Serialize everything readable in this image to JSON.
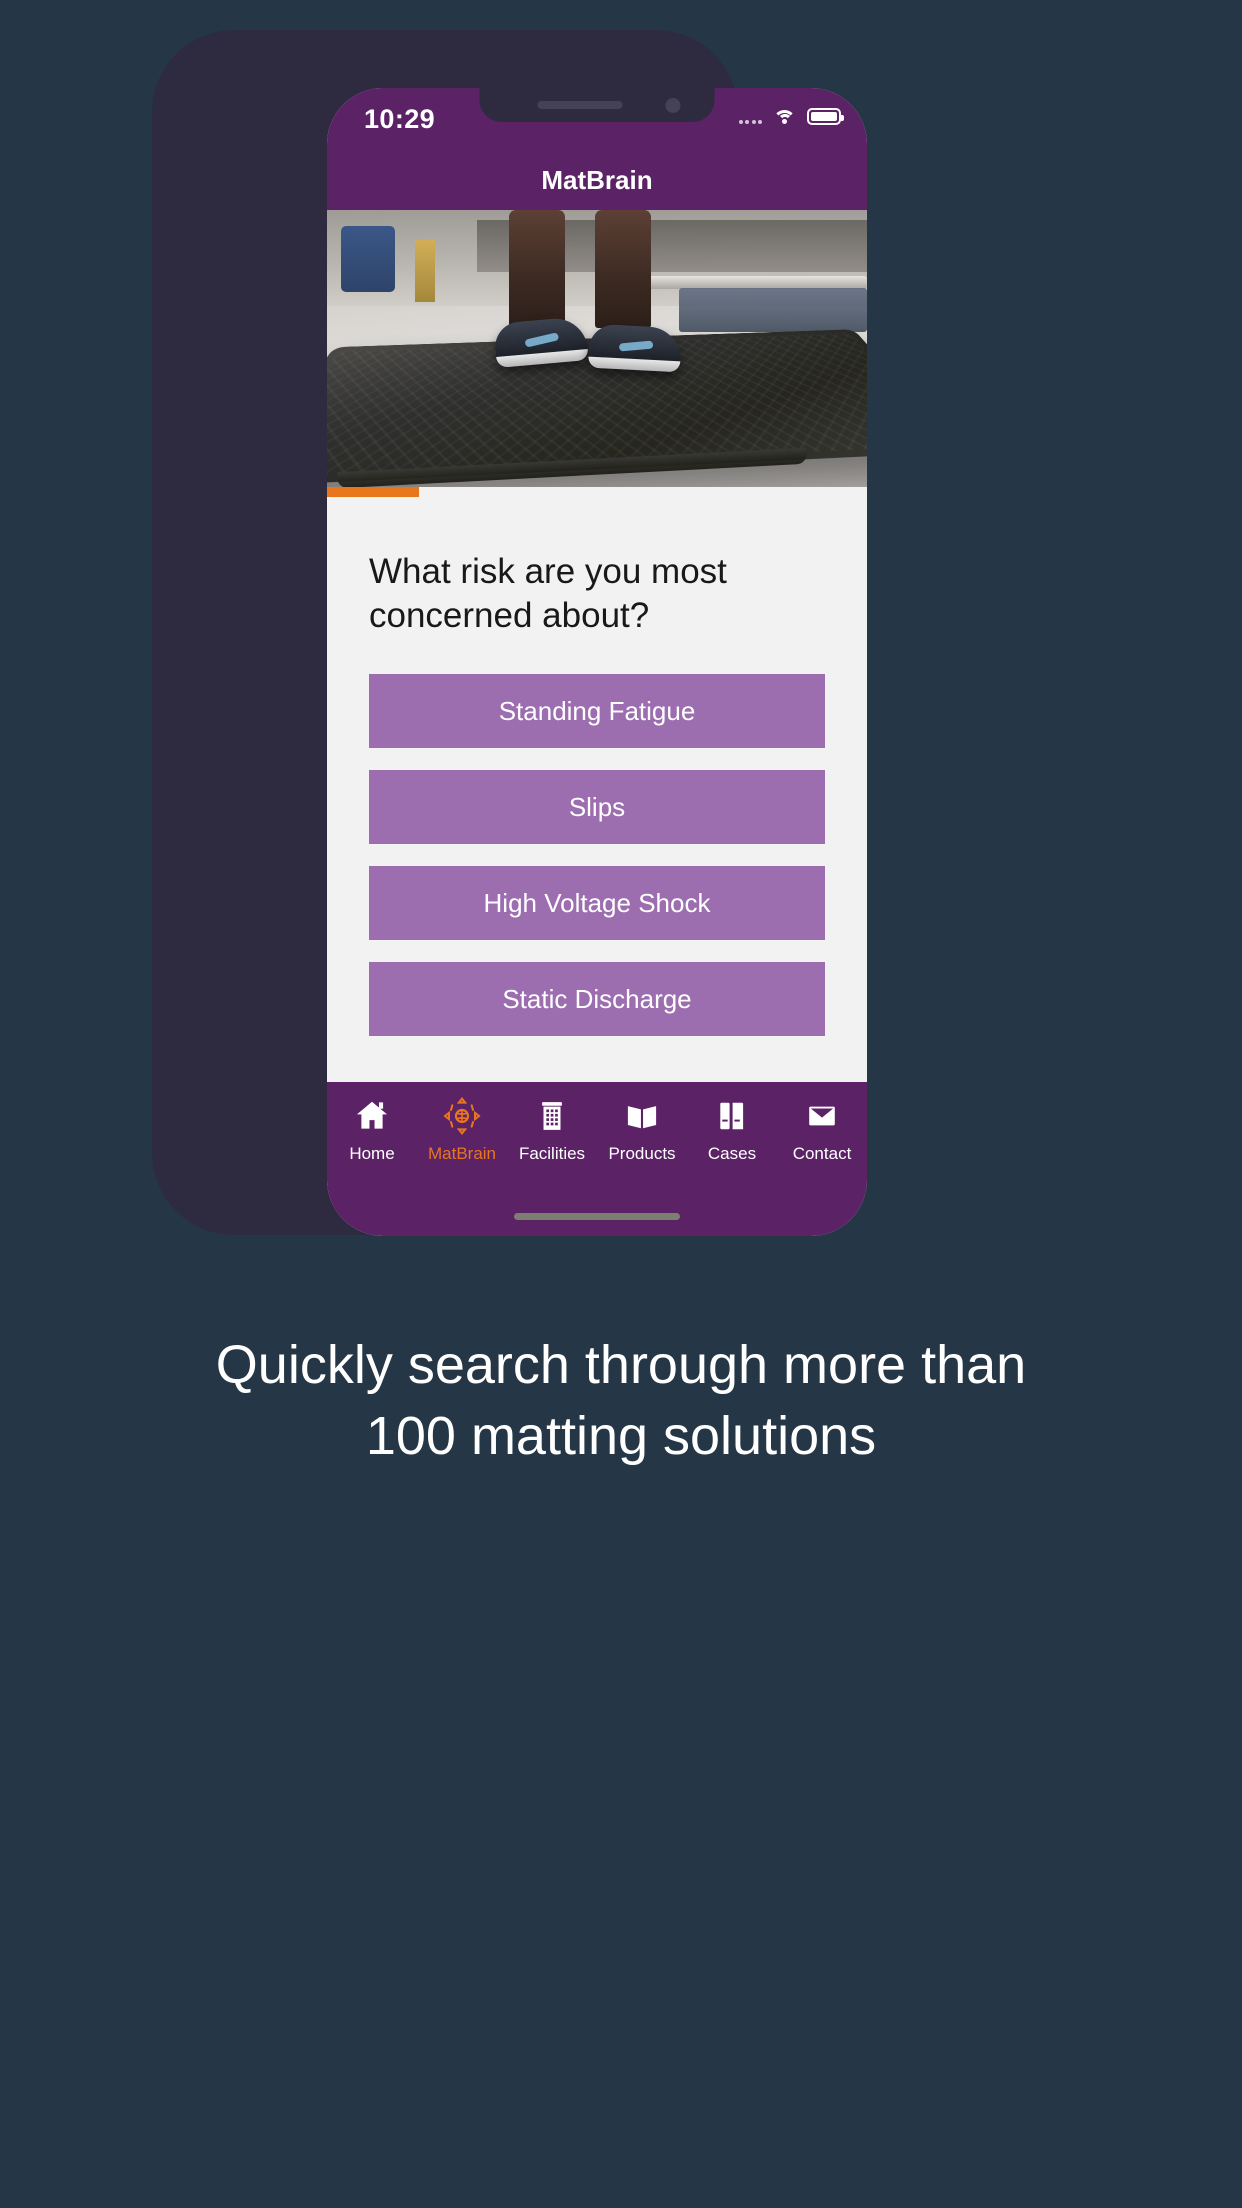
{
  "status_bar": {
    "time": "10:29",
    "signal_icon": "signal-dots-icon",
    "wifi_icon": "wifi-icon",
    "battery_icon": "battery-full-icon"
  },
  "header": {
    "title": "MatBrain"
  },
  "hero": {
    "alt": "worker standing on black anti-fatigue mat in industrial facility"
  },
  "progress": {
    "percent": 17,
    "fill_color": "#e8761d"
  },
  "quiz": {
    "question": "What risk are you most concerned about?",
    "options": [
      {
        "label": "Standing Fatigue"
      },
      {
        "label": "Slips"
      },
      {
        "label": "High Voltage Shock"
      },
      {
        "label": "Static Discharge"
      }
    ]
  },
  "tabbar": {
    "items": [
      {
        "label": "Home",
        "icon": "home-icon",
        "active": false
      },
      {
        "label": "MatBrain",
        "icon": "brain-icon",
        "active": true
      },
      {
        "label": "Facilities",
        "icon": "building-icon",
        "active": false
      },
      {
        "label": "Products",
        "icon": "book-open-icon",
        "active": false
      },
      {
        "label": "Cases",
        "icon": "books-icon",
        "active": false
      },
      {
        "label": "Contact",
        "icon": "envelope-icon",
        "active": false
      }
    ]
  },
  "caption": {
    "line1": "Quickly search through more than",
    "line2": "100 matting solutions"
  },
  "colors": {
    "background": "#253746",
    "brand_purple": "#5c2266",
    "option_purple": "#9c6eb0",
    "accent_orange": "#e8761d",
    "surface": "#f2f2f2"
  }
}
